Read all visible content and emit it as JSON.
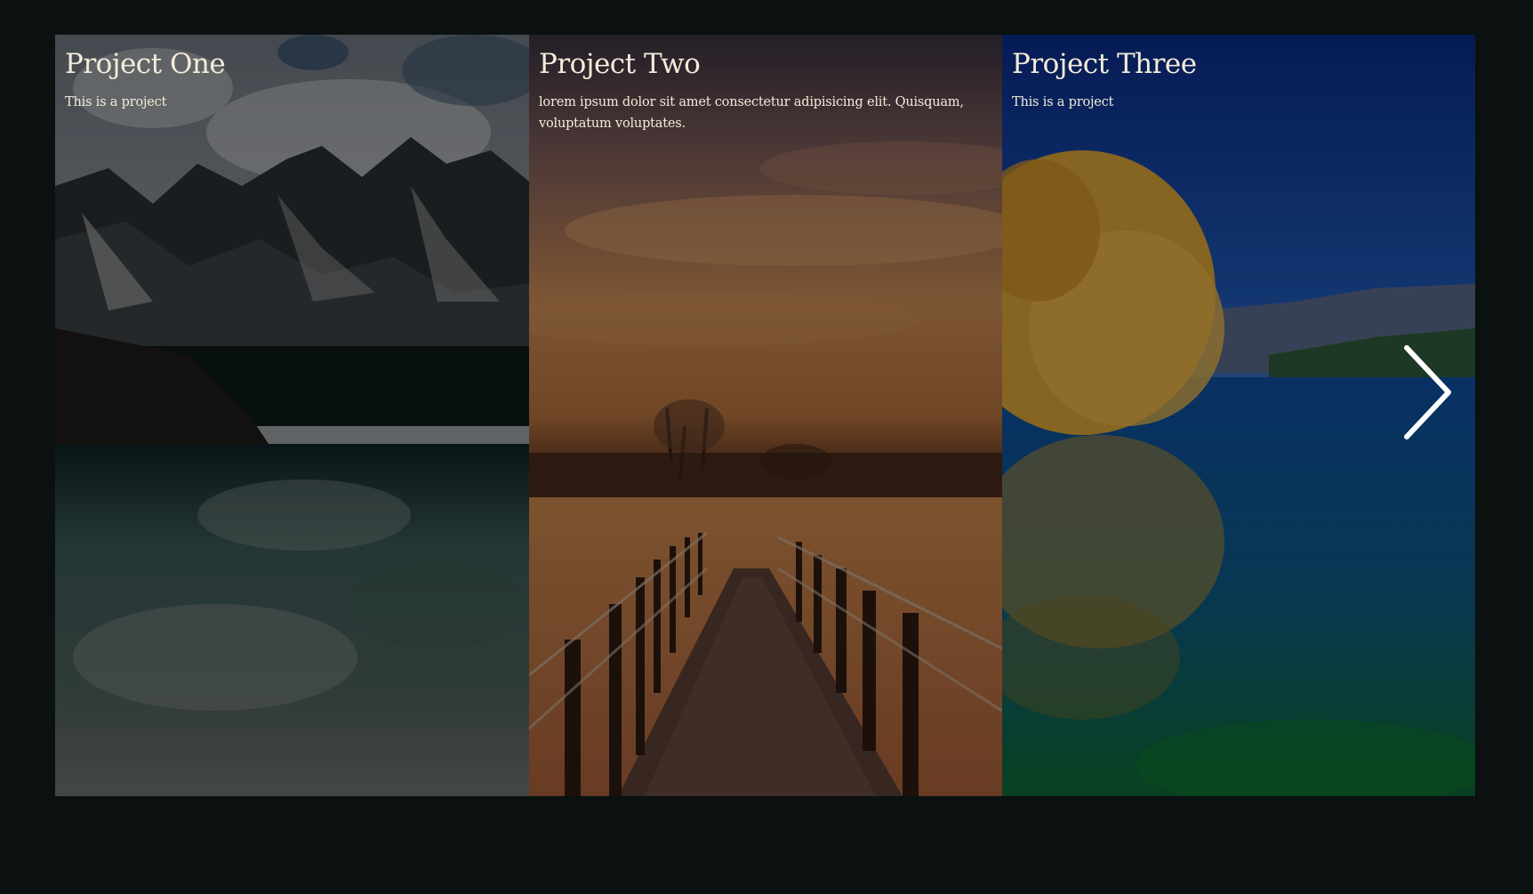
{
  "carousel": {
    "projects": [
      {
        "title": "Project One",
        "description": "This is a project",
        "image": "mountain-lake-image"
      },
      {
        "title": "Project Two",
        "description": "lorem ipsum dolor sit amet consectetur adipisicing elit. Quisquam, voluptatum voluptates.",
        "image": "boardwalk-sunset-image"
      },
      {
        "title": "Project Three",
        "description": "This is a project",
        "image": "willow-lake-image"
      }
    ],
    "next_icon": "chevron-right-icon"
  },
  "colors": {
    "page_background": "#0a1110",
    "text": "#f3ecd9",
    "arrow": "#ffffff"
  }
}
